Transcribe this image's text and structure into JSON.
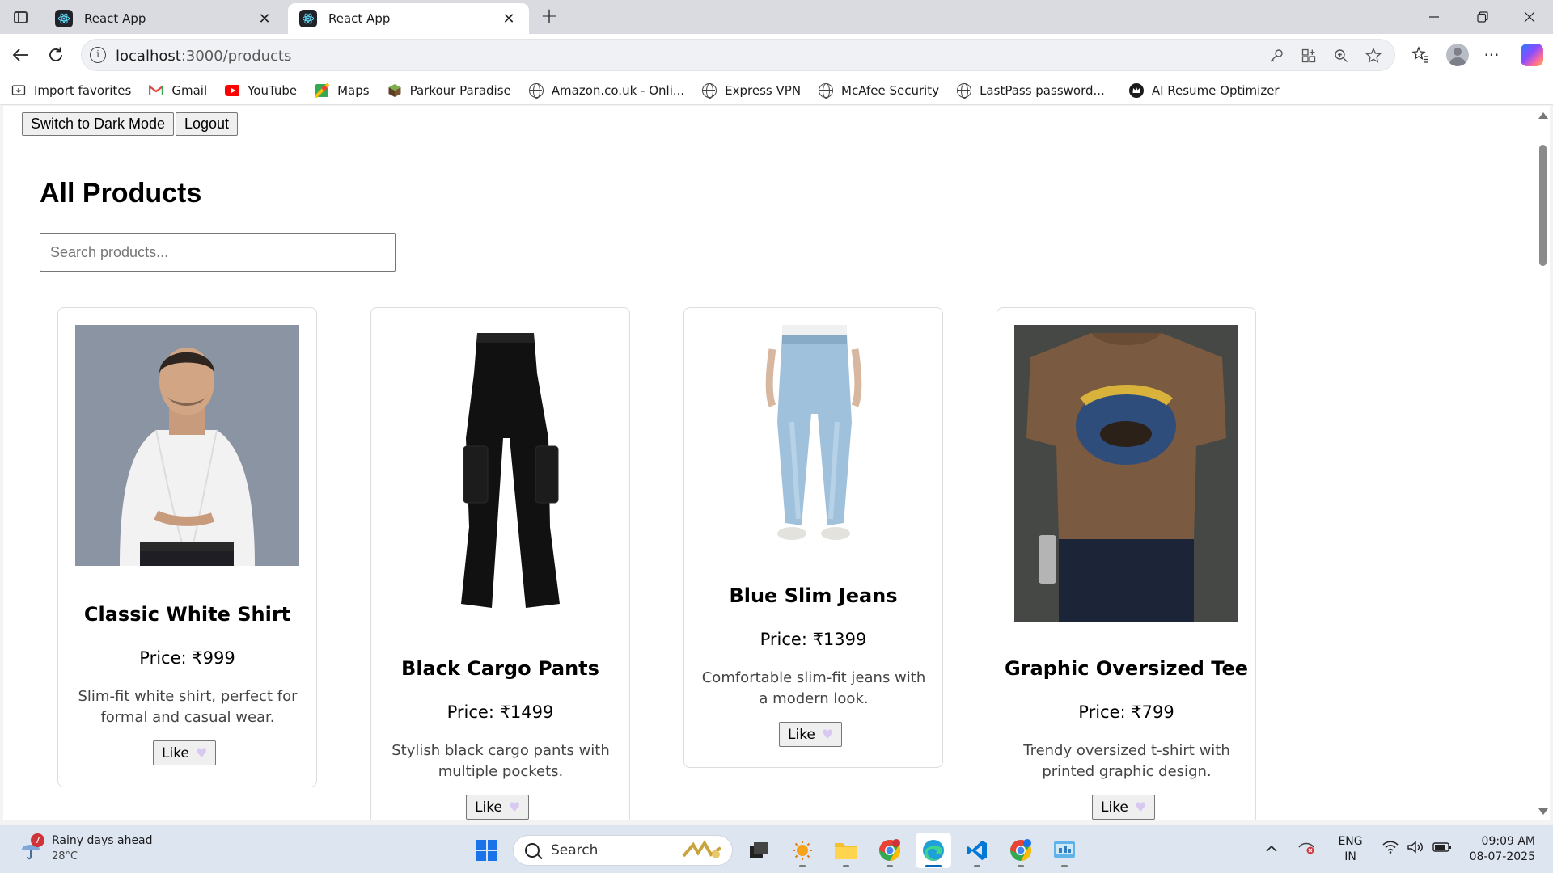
{
  "browser": {
    "tabs": [
      {
        "title": "React App",
        "active": false
      },
      {
        "title": "React App",
        "active": true
      }
    ],
    "url_host": "localhost",
    "url_path": ":3000/products",
    "bookmarks": [
      {
        "label": "Import favorites",
        "icon": "import-icon"
      },
      {
        "label": "Gmail",
        "icon": "gmail-icon"
      },
      {
        "label": "YouTube",
        "icon": "youtube-icon"
      },
      {
        "label": "Maps",
        "icon": "maps-icon"
      },
      {
        "label": "Parkour Paradise",
        "icon": "cube-icon"
      },
      {
        "label": "Amazon.co.uk - Onli...",
        "icon": "globe-icon"
      },
      {
        "label": "Express VPN",
        "icon": "globe-icon"
      },
      {
        "label": "McAfee Security",
        "icon": "globe-icon"
      },
      {
        "label": "LastPass password...",
        "icon": "globe-icon"
      },
      {
        "label": "AI Resume Optimizer",
        "icon": "crown-icon"
      }
    ]
  },
  "page": {
    "dark_mode_button": "Switch to Dark Mode",
    "logout_button": "Logout",
    "title": "All Products",
    "search_placeholder": "Search products...",
    "like_label": "Like",
    "products": [
      {
        "name": "Classic White Shirt",
        "price": "Price: ₹999",
        "description": "Slim-fit white shirt, perfect for formal and casual wear."
      },
      {
        "name": "Black Cargo Pants",
        "price": "Price: ₹1499",
        "description": "Stylish black cargo pants with multiple pockets."
      },
      {
        "name": "Blue Slim Jeans",
        "price": "Price: ₹1399",
        "description": "Comfortable slim-fit jeans with a modern look."
      },
      {
        "name": "Graphic Oversized Tee",
        "price": "Price: ₹799",
        "description": "Trendy oversized t-shirt with printed graphic design."
      }
    ]
  },
  "taskbar": {
    "weather_title": "Rainy days ahead",
    "weather_temp": "28°C",
    "weather_badge": "7",
    "search_label": "Search",
    "language_line1": "ENG",
    "language_line2": "IN",
    "time": "09:09 AM",
    "date": "08-07-2025"
  },
  "colors": {
    "tabstrip": "#d9dbe1",
    "taskbar": "#dde5f1",
    "accent": "#0067c0",
    "heart": "#d9c8f0"
  }
}
